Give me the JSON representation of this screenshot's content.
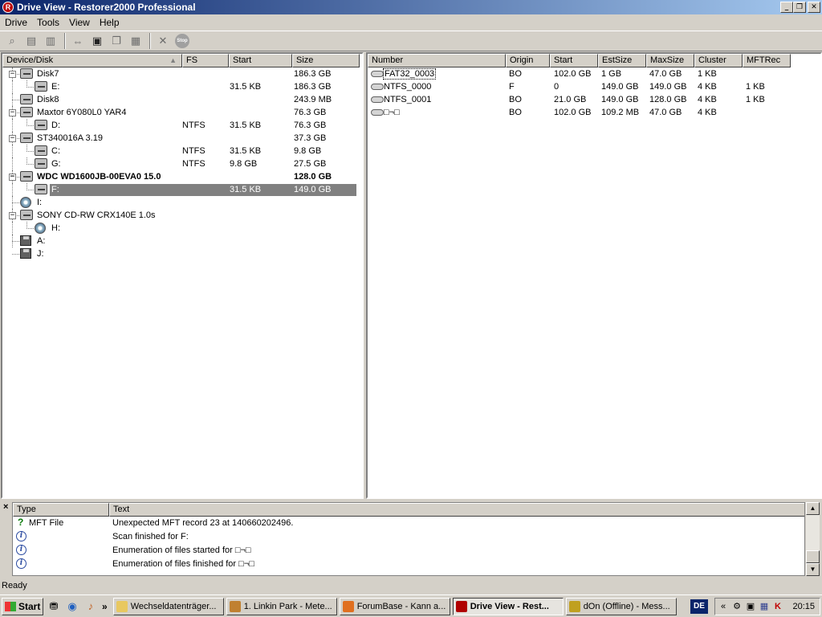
{
  "window": {
    "title": "Drive View - Restorer2000 Professional",
    "app_icon_glyph": "R",
    "minimize_glyph": "_",
    "maximize_glyph": "❐",
    "close_glyph": "✕"
  },
  "menu": [
    "Drive",
    "Tools",
    "View",
    "Help"
  ],
  "toolbar": {
    "icons": [
      "scan-icon",
      "open-icon",
      "save-icon",
      "swap-icon",
      "mount-icon",
      "copy-icon",
      "paste-icon",
      "delete-icon",
      "stop-icon"
    ],
    "stop_label": "Stop"
  },
  "left_table": {
    "columns": [
      "Device/Disk",
      "FS",
      "Start",
      "Size"
    ],
    "sort_arrow": "▲",
    "rows": [
      {
        "name": "Disk7",
        "fs": "",
        "start": "",
        "size": "186.3 GB",
        "level": 0,
        "icon": "hdd",
        "expander": "−"
      },
      {
        "name": "E:",
        "fs": "",
        "start": "31.5 KB",
        "size": "186.3 GB",
        "level": 1,
        "icon": "hdd"
      },
      {
        "name": "Disk8",
        "fs": "",
        "start": "",
        "size": "243.9 MB",
        "level": 0,
        "icon": "hdd"
      },
      {
        "name": "Maxtor 6Y080L0 YAR4",
        "fs": "",
        "start": "",
        "size": "76.3 GB",
        "level": 0,
        "icon": "hdd",
        "expander": "−"
      },
      {
        "name": "D:",
        "fs": "NTFS",
        "start": "31.5 KB",
        "size": "76.3 GB",
        "level": 1,
        "icon": "hdd"
      },
      {
        "name": "ST340016A 3.19",
        "fs": "",
        "start": "",
        "size": "37.3 GB",
        "level": 0,
        "icon": "hdd",
        "expander": "−"
      },
      {
        "name": "C:",
        "fs": "NTFS",
        "start": "31.5 KB",
        "size": "9.8 GB",
        "level": 1,
        "icon": "hdd"
      },
      {
        "name": "G:",
        "fs": "NTFS",
        "start": "9.8 GB",
        "size": "27.5 GB",
        "level": 1,
        "icon": "hdd"
      },
      {
        "name": "WDC WD1600JB-00EVA0 15.0",
        "fs": "",
        "start": "",
        "size": "128.0 GB",
        "level": 0,
        "icon": "hdd",
        "expander": "−",
        "bold": true
      },
      {
        "name": "F:",
        "fs": "",
        "start": "31.5 KB",
        "size": "149.0 GB",
        "level": 1,
        "icon": "hdd",
        "selected": true
      },
      {
        "name": "I:",
        "fs": "",
        "start": "",
        "size": "",
        "level": 0,
        "icon": "cd"
      },
      {
        "name": "SONY CD-RW CRX140E 1.0s",
        "fs": "",
        "start": "",
        "size": "",
        "level": 0,
        "icon": "hdd",
        "expander": "−"
      },
      {
        "name": "H:",
        "fs": "",
        "start": "",
        "size": "",
        "level": 1,
        "icon": "cd"
      },
      {
        "name": "A:",
        "fs": "",
        "start": "",
        "size": "",
        "level": 0,
        "icon": "floppy"
      },
      {
        "name": "J:",
        "fs": "",
        "start": "",
        "size": "",
        "level": 0,
        "icon": "floppy"
      }
    ]
  },
  "right_table": {
    "columns": [
      "Number",
      "Origin",
      "Start",
      "EstSize",
      "MaxSize",
      "Cluster",
      "MFTRec"
    ],
    "rows": [
      {
        "number": "FAT32_0003",
        "origin": "BO",
        "start": "102.0 GB",
        "estsize": "1 GB",
        "maxsize": "47.0 GB",
        "cluster": "1 KB",
        "mftrec": "",
        "focused": true
      },
      {
        "number": "NTFS_0000",
        "origin": "F",
        "start": "0",
        "estsize": "149.0 GB",
        "maxsize": "149.0 GB",
        "cluster": "4 KB",
        "mftrec": "1 KB"
      },
      {
        "number": "NTFS_0001",
        "origin": "BO",
        "start": "21.0 GB",
        "estsize": "149.0 GB",
        "maxsize": "128.0 GB",
        "cluster": "4 KB",
        "mftrec": "1 KB"
      },
      {
        "number": "□¬□",
        "origin": "BO",
        "start": "102.0 GB",
        "estsize": "109.2 MB",
        "maxsize": "47.0 GB",
        "cluster": "4 KB",
        "mftrec": ""
      }
    ]
  },
  "log": {
    "close_glyph": "×",
    "columns": [
      "Type",
      "Text"
    ],
    "rows": [
      {
        "icon": "question",
        "type": "MFT File",
        "text": "Unexpected MFT record 23 at 140660202496."
      },
      {
        "icon": "info",
        "type": "",
        "text": "Scan finished for F:"
      },
      {
        "icon": "info",
        "type": "",
        "text": "Enumeration of files started for □¬□"
      },
      {
        "icon": "info",
        "type": "",
        "text": "Enumeration of files finished for □¬□"
      }
    ],
    "question_glyph": "?",
    "info_glyph": "i",
    "scroll_up": "▲",
    "scroll_down": "▼"
  },
  "status": "Ready",
  "taskbar": {
    "start_label": "Start",
    "chevron": "»",
    "tasks": [
      {
        "label": "Wechseldatenträger...",
        "color": "#e8c860",
        "active": false
      },
      {
        "label": "1. Linkin Park - Mete...",
        "color": "#c08030",
        "active": false
      },
      {
        "label": "ForumBase - Kann a...",
        "color": "#e07020",
        "active": false
      },
      {
        "label": "Drive View - Rest...",
        "color": "#b00000",
        "active": true
      },
      {
        "label": "dOn (Offline) - Mess...",
        "color": "#c0a020",
        "active": false
      }
    ],
    "lang": "DE",
    "tray_chevron": "«",
    "clock": "20:15"
  }
}
